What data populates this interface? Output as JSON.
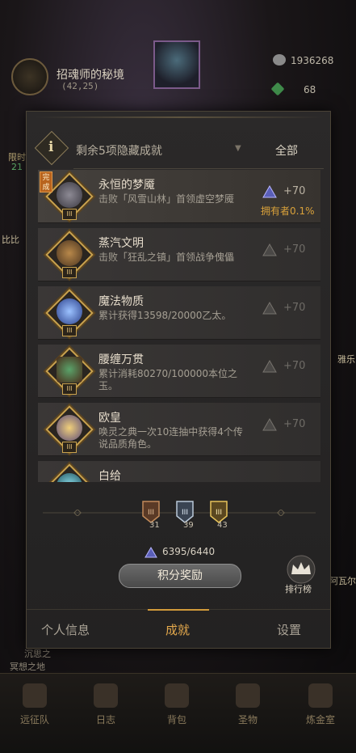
{
  "map": {
    "title": "招魂师的秘境",
    "coord": "(42,25)"
  },
  "resources": {
    "currency": "1936268",
    "gems": "68"
  },
  "edge": {
    "left_timer": "限时",
    "left_timer_val": "21",
    "left_tag": "比比",
    "right_1": "雅乐",
    "right_2": "阿瓦尔",
    "bottom_left": "沉思之",
    "dream": "冥想之地"
  },
  "filter": {
    "icon": "i",
    "text": "剩余5项隐藏成就",
    "arrow": "▼",
    "all": "全部"
  },
  "achievements": [
    {
      "title": "永恒的梦魇",
      "desc": "击败「风雪山林」首领虚空梦魇",
      "reward": "+70",
      "owner": "拥有者0.1%",
      "done": "完成",
      "tier": "III",
      "active": true,
      "art": "#5c5a63"
    },
    {
      "title": "蒸汽文明",
      "desc": "击败「狂乱之镇」首领战争傀儡",
      "reward": "+70",
      "owner": "",
      "done": "",
      "tier": "III",
      "active": false,
      "art": "#8a6a3a"
    },
    {
      "title": "魔法物质",
      "desc": "累计获得13598/20000乙太。",
      "reward": "+70",
      "owner": "",
      "done": "",
      "tier": "III",
      "active": false,
      "art": "#3f6fd6"
    },
    {
      "title": "腰缠万贯",
      "desc": "累计消耗80270/100000本位之玉。",
      "reward": "+70",
      "owner": "",
      "done": "",
      "tier": "III",
      "active": false,
      "art": "#3f7f4a"
    },
    {
      "title": "欧皇",
      "desc": "唤灵之典一次10连抽中获得4个传说品质角色。",
      "reward": "+70",
      "owner": "",
      "done": "",
      "tier": "III",
      "active": false,
      "art": "#d9b34a"
    },
    {
      "title": "白给",
      "desc": "",
      "reward": "",
      "owner": "",
      "done": "",
      "tier": "III",
      "active": false,
      "art": "#3fa6b8"
    }
  ],
  "ranks": [
    {
      "count": "31"
    },
    {
      "count": "39"
    },
    {
      "count": "43"
    }
  ],
  "points": "6395/6440",
  "reward_button": "积分奖励",
  "leaderboard": "排行榜",
  "tabs": [
    "个人信息",
    "成就",
    "设置"
  ],
  "nav": [
    "远征队",
    "日志",
    "背包",
    "圣物",
    "炼金室"
  ],
  "colors": {
    "accent": "#e3a84c",
    "owner": "#d9a13a",
    "frame": "#c9a24e"
  }
}
